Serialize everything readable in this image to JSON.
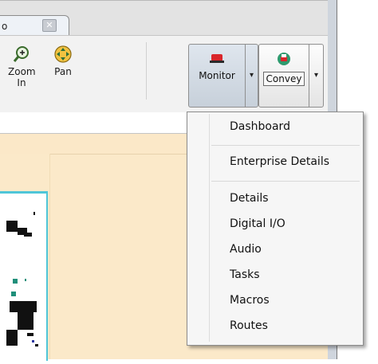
{
  "tab": {
    "label": "o",
    "close_glyph": "✕"
  },
  "toolbar": {
    "zoom_in_label_line1": "Zoom",
    "zoom_in_label_line2": "In",
    "pan_label": "Pan",
    "monitor_label": "Monitor",
    "convey_label": "Convey",
    "dropdown_glyph": "▾"
  },
  "menu": {
    "items": [
      {
        "label": "Dashboard"
      },
      {
        "label": "Enterprise Details"
      },
      {
        "label": "Details"
      },
      {
        "label": "Digital I/O"
      },
      {
        "label": "Audio"
      },
      {
        "label": "Tasks"
      },
      {
        "label": "Macros"
      },
      {
        "label": "Routes"
      }
    ]
  },
  "colors": {
    "panel_bg": "#fbe9c9",
    "map_border": "#4fc6d8",
    "menu_bg": "#f6f6f6"
  },
  "icons": {
    "zoom_in": "zoom-in-icon",
    "pan": "pan-icon",
    "monitor": "monitor-icon",
    "convey": "convey-icon"
  }
}
